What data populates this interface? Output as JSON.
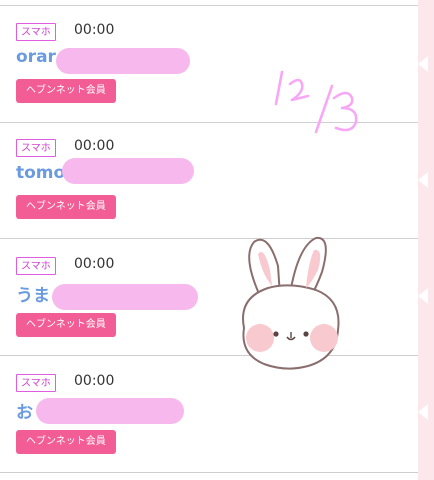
{
  "items": [
    {
      "device": "スマホ",
      "time": "00:00",
      "name": "orar",
      "member": "ヘブンネット会員"
    },
    {
      "device": "スマホ",
      "time": "00:00",
      "name": "tomo",
      "member": "ヘブンネット会員"
    },
    {
      "device": "スマホ",
      "time": "00:00",
      "name": "うま",
      "member": "ヘブンネット会員"
    },
    {
      "device": "スマホ",
      "time": "00:00",
      "name": "お",
      "member": "ヘブンネット会員"
    }
  ],
  "handwritten_date": "12/3",
  "colors": {
    "badge": "#d23fd2",
    "name": "#6a9be0",
    "member_button": "#f25d95",
    "censor_blot": "#f7b8ee",
    "side_panel": "#fce7ec"
  },
  "icons": [
    "bunny-sticker-icon"
  ]
}
